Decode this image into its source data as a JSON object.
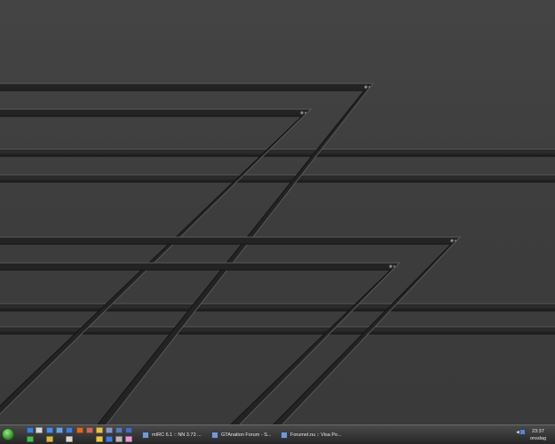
{
  "quick_launch": [
    {
      "icon": "desktop-icon",
      "color": "#3f7fd0"
    },
    {
      "icon": "winamp-icon",
      "color": "#d8d8d8"
    },
    {
      "icon": "media-icon",
      "color": "#4a8be8"
    },
    {
      "icon": "shield-icon",
      "color": "#6aa0e0"
    },
    {
      "icon": "ie-icon",
      "color": "#3d7dd8"
    },
    {
      "icon": "game-icon",
      "color": "#d86a2a"
    },
    {
      "icon": "app-icon",
      "color": "#c86a5a"
    },
    {
      "icon": "folder-icon",
      "color": "#e8c04a"
    },
    {
      "icon": "tool-icon",
      "color": "#8898b8"
    },
    {
      "icon": "tool2-icon",
      "color": "#5a78b8"
    },
    {
      "icon": "network-icon",
      "color": "#4a6ab8"
    },
    {
      "icon": "chat-icon",
      "color": "#4ab85a"
    },
    {
      "icon": "folder2-icon",
      "color": "#d8b84a"
    },
    {
      "icon": "mail-icon",
      "color": "#d8d8d8"
    },
    {
      "icon": "star-icon",
      "color": "#e8c84a"
    },
    {
      "icon": "globe-icon",
      "color": "#4a7ad8"
    },
    {
      "icon": "disc-icon",
      "color": "#b8b8b8"
    },
    {
      "icon": "image-icon",
      "color": "#e89ad8"
    }
  ],
  "tasks": [
    {
      "label": "mIRC 6.1 :: NN 3.73 ..."
    },
    {
      "label": "GTAnation Forum - S..."
    },
    {
      "label": "Forumet.nu :: Visa Po..."
    }
  ],
  "tray": {
    "time": "23:37",
    "day": "onsdag"
  }
}
